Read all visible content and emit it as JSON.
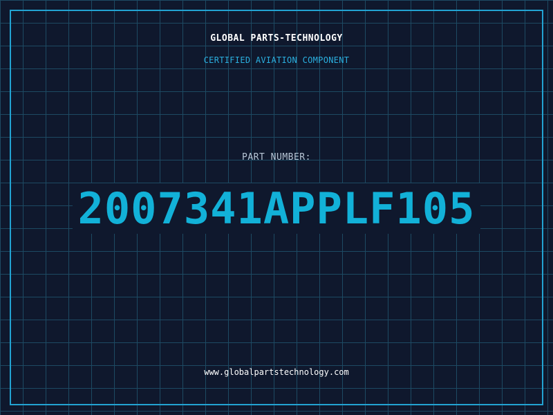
{
  "header": {
    "company": "GLOBAL PARTS-TECHNOLOGY",
    "subtitle": "CERTIFIED AVIATION COMPONENT"
  },
  "part": {
    "label": "PART NUMBER:",
    "number": "2007341APPLF105"
  },
  "footer": {
    "website": "www.globalpartstechnology.com"
  },
  "colors": {
    "background": "#0f182d",
    "grid": "#1d4a63",
    "frame": "#22a3d2",
    "accent": "#12b1d8"
  }
}
